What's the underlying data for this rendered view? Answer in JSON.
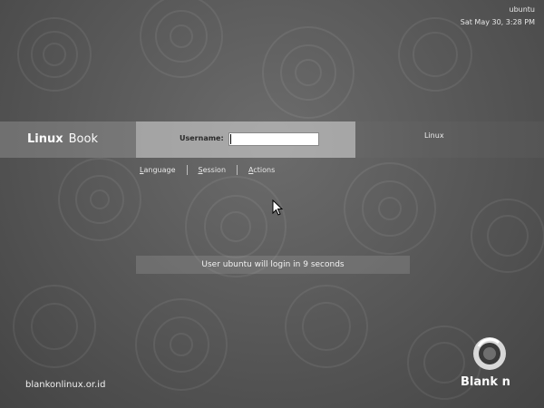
{
  "top_panel": {
    "username": "ubuntu",
    "datetime": "Sat May 30,  3:28 PM"
  },
  "brand": {
    "word1": "Linux",
    "word2": "Book"
  },
  "login": {
    "username_label": "Username:",
    "username_value": "",
    "host_label": "Linux"
  },
  "menu": {
    "items": [
      {
        "label": "Language"
      },
      {
        "label": "Session"
      },
      {
        "label": "Actions"
      }
    ]
  },
  "status_message": "User ubuntu will login in 9 seconds",
  "footer": {
    "url": "blankonlinux.or.id",
    "logo_text": "Blank n"
  },
  "colors": {
    "background": "#5a5a5a",
    "band_mid": "#d6d6d6",
    "text_light": "#f0f0f0"
  },
  "icons": {
    "logo": "blankon-logo-icon",
    "pointer": "mouse-pointer-icon"
  }
}
